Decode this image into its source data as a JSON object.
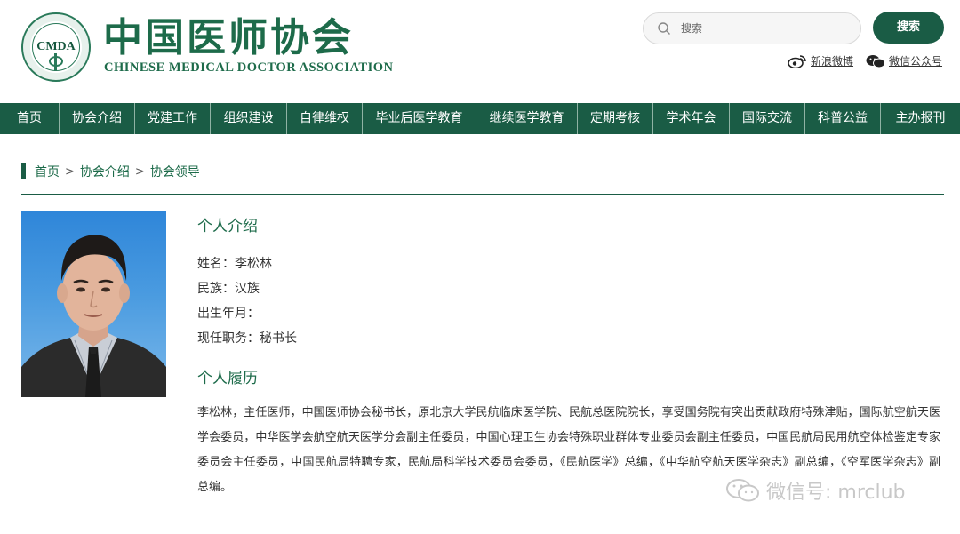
{
  "header": {
    "logo_seal_text": "CMDA",
    "logo_cn": "中国医师协会",
    "logo_en": "CHINESE MEDICAL DOCTOR ASSOCIATION",
    "search_placeholder": "搜索",
    "search_button": "搜索",
    "weibo_label": "新浪微博",
    "wechat_label": "微信公众号"
  },
  "nav": {
    "items": [
      "首页",
      "协会介绍",
      "党建工作",
      "组织建设",
      "自律维权",
      "毕业后医学教育",
      "继续医学教育",
      "定期考核",
      "学术年会",
      "国际交流",
      "科普公益",
      "主办报刊"
    ]
  },
  "breadcrumb": {
    "items": [
      "首页",
      "协会介绍",
      "协会领导"
    ]
  },
  "profile": {
    "intro_title": "个人介绍",
    "name_line": "姓名：李松林",
    "ethnicity_line": "民族：汉族",
    "birth_line": "出生年月：",
    "position_line": "现任职务：秘书长",
    "resume_title": "个人履历",
    "bio": "李松林，主任医师，中国医师协会秘书长，原北京大学民航临床医学院、民航总医院院长，享受国务院有突出贡献政府特殊津贴，国际航空航天医学会委员，中华医学会航空航天医学分会副主任委员，中国心理卫生协会特殊职业群体专业委员会副主任委员，中国民航局民用航空体检鉴定专家委员会主任委员，中国民航局特聘专家，民航局科学技术委员会委员，《民航医学》总编，《中华航空航天医学杂志》副总编，《空军医学杂志》副总编。"
  },
  "watermark": "微信号: mrclub",
  "colors": {
    "brand_green": "#1a5c45",
    "logo_green": "#1d6b4a"
  }
}
